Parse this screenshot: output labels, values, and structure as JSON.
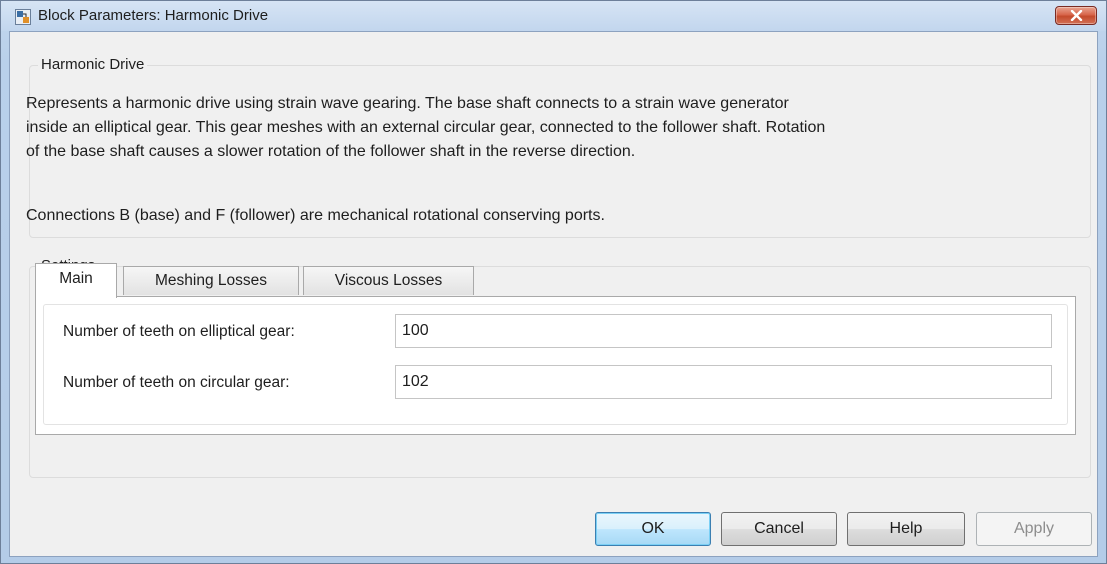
{
  "window": {
    "title": "Block Parameters: Harmonic Drive",
    "icon": "simulink-block-icon",
    "close_icon": "close-x-icon"
  },
  "block": {
    "legend": "Harmonic Drive",
    "description_lines": [
      "Represents a harmonic drive using strain wave gearing. The base shaft connects to a strain wave generator",
      "inside an elliptical gear. This gear meshes with an external circular gear, connected to the follower shaft. Rotation",
      "of the base shaft causes a slower rotation of the follower shaft in the reverse direction."
    ],
    "connections": "Connections B (base) and F (follower) are mechanical rotational conserving ports."
  },
  "settings": {
    "legend": "Settings",
    "tabs": [
      {
        "label": "Main",
        "active": true
      },
      {
        "label": "Meshing Losses",
        "active": false
      },
      {
        "label": "Viscous Losses",
        "active": false
      }
    ],
    "params": [
      {
        "label": "Number of teeth on elliptical gear:",
        "value": "100"
      },
      {
        "label": "Number of teeth on circular gear:",
        "value": "102"
      }
    ]
  },
  "buttons": {
    "ok": "OK",
    "cancel": "Cancel",
    "help": "Help",
    "apply": "Apply"
  },
  "colors": {
    "title_gradient": "#c2d6ee",
    "close_button": "#c44a2c",
    "default_button_border": "#3c7fb1",
    "client_bg": "#f0f0f0"
  }
}
